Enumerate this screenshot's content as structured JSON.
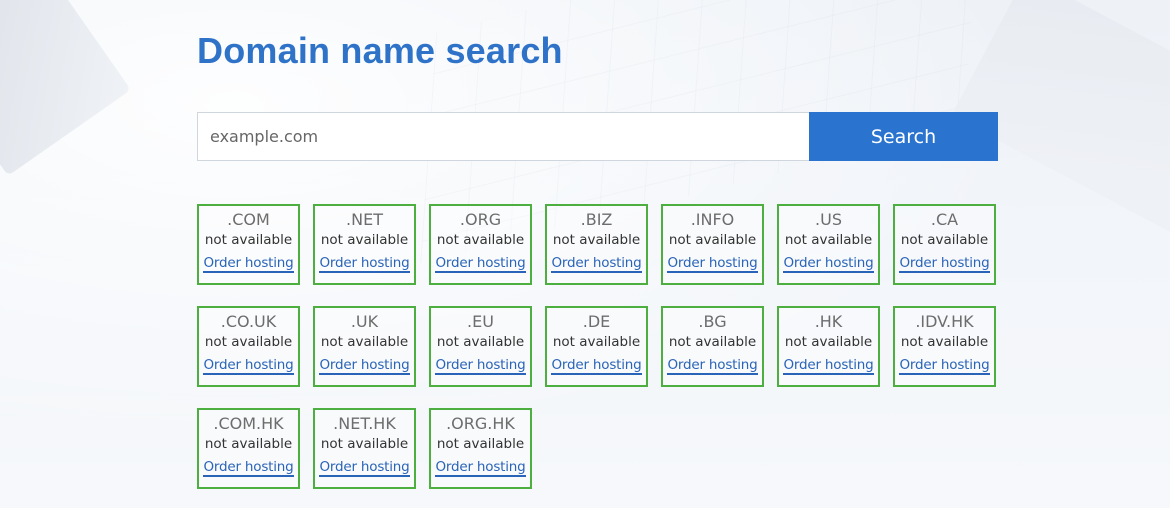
{
  "page": {
    "title": "Domain name search"
  },
  "search": {
    "placeholder": "example.com",
    "value": "",
    "button_label": "Search"
  },
  "colors": {
    "title": "#2f73c9",
    "button": "#2a74cf",
    "card_border": "#4caf3f",
    "link": "#2a64b8"
  },
  "domains": [
    {
      "tld": ".COM",
      "status": "not available",
      "action": "Order hosting"
    },
    {
      "tld": ".NET",
      "status": "not available",
      "action": "Order hosting"
    },
    {
      "tld": ".ORG",
      "status": "not available",
      "action": "Order hosting"
    },
    {
      "tld": ".BIZ",
      "status": "not available",
      "action": "Order hosting"
    },
    {
      "tld": ".INFO",
      "status": "not available",
      "action": "Order hosting"
    },
    {
      "tld": ".US",
      "status": "not available",
      "action": "Order hosting"
    },
    {
      "tld": ".CA",
      "status": "not available",
      "action": "Order hosting"
    },
    {
      "tld": ".CO.UK",
      "status": "not available",
      "action": "Order hosting"
    },
    {
      "tld": ".UK",
      "status": "not available",
      "action": "Order hosting"
    },
    {
      "tld": ".EU",
      "status": "not available",
      "action": "Order hosting"
    },
    {
      "tld": ".DE",
      "status": "not available",
      "action": "Order hosting"
    },
    {
      "tld": ".BG",
      "status": "not available",
      "action": "Order hosting"
    },
    {
      "tld": ".HK",
      "status": "not available",
      "action": "Order hosting"
    },
    {
      "tld": ".IDV.HK",
      "status": "not available",
      "action": "Order hosting"
    },
    {
      "tld": ".COM.HK",
      "status": "not available",
      "action": "Order hosting"
    },
    {
      "tld": ".NET.HK",
      "status": "not available",
      "action": "Order hosting"
    },
    {
      "tld": ".ORG.HK",
      "status": "not available",
      "action": "Order hosting"
    }
  ]
}
